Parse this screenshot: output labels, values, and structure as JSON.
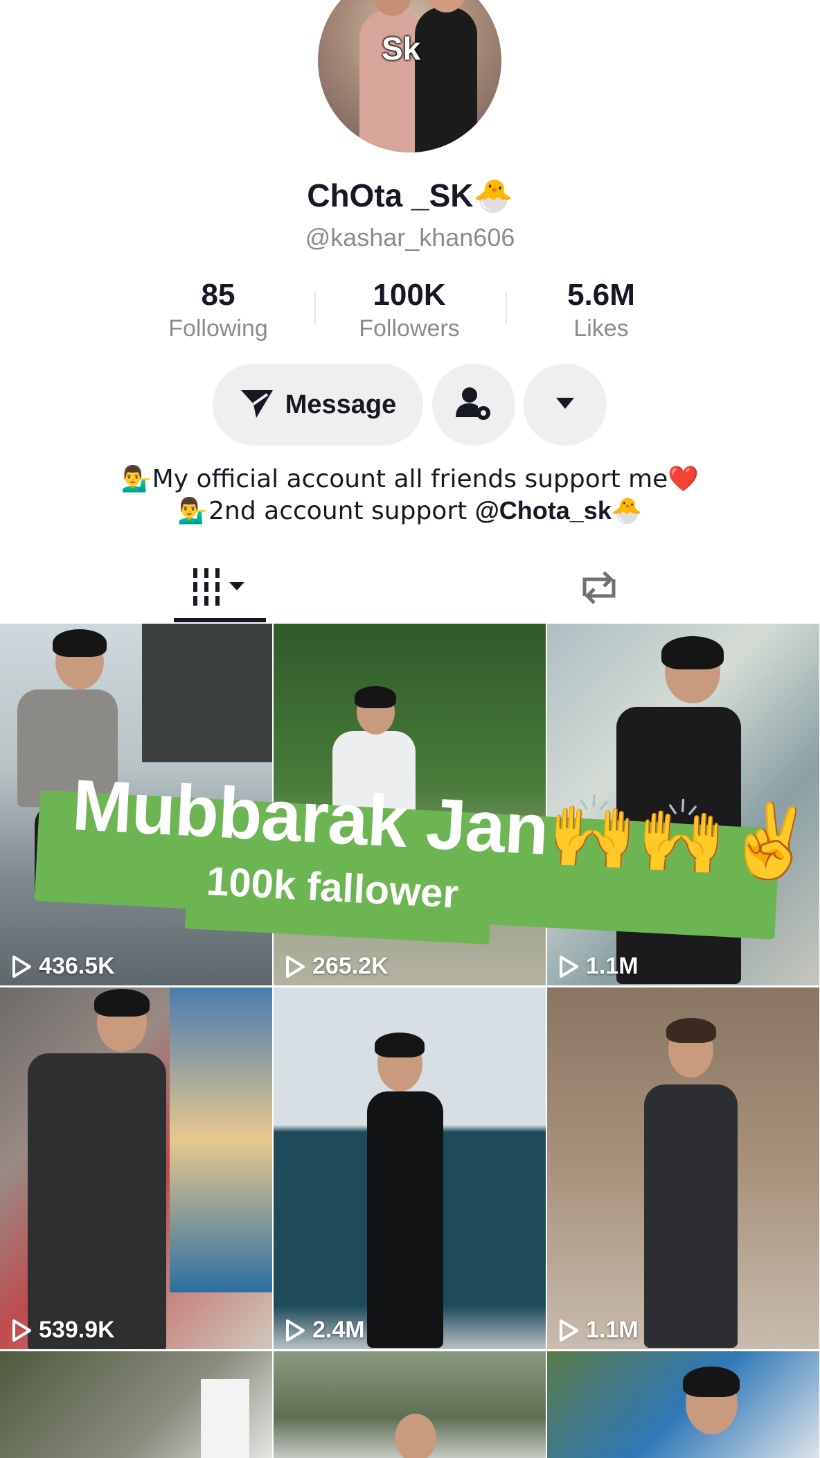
{
  "profile": {
    "avatar_overlay_text": "Sk",
    "display_name": "ChOta _SK",
    "display_name_emoji": "🐣",
    "username": "@kashar_khan606"
  },
  "stats": [
    {
      "value": "85",
      "label": "Following"
    },
    {
      "value": "100K",
      "label": "Followers"
    },
    {
      "value": "5.6M",
      "label": "Likes"
    }
  ],
  "actions": {
    "message_label": "Message",
    "message_icon": "send-icon",
    "friend_settings_icon": "person-gear-icon",
    "more_icon": "caret-down-icon"
  },
  "bio": {
    "line1": "💁‍♂️My official account all friends support me❤️",
    "line2_prefix": "💁‍♂️2nd account support ",
    "line2_mention": "@Chota_sk",
    "line2_emoji": "🐣"
  },
  "tabs": {
    "videos_icon": "grid-icon",
    "reposts_icon": "repost-icon"
  },
  "videos": [
    {
      "views": "436.5K"
    },
    {
      "views": "265.2K"
    },
    {
      "views": "1.1M"
    },
    {
      "views": "539.9K"
    },
    {
      "views": "2.4M"
    },
    {
      "views": "1.1M"
    },
    {
      "views": ""
    },
    {
      "views": ""
    },
    {
      "views": ""
    }
  ],
  "pinned_banner": {
    "title": "Mubbarak Jan",
    "title_emoji": "🙌🙌✌️",
    "subtitle": "100k fallower"
  },
  "colors": {
    "accent_text": "#161823",
    "muted_text": "#8a8b91",
    "button_bg": "#efefef",
    "banner_green": "#6db552"
  }
}
